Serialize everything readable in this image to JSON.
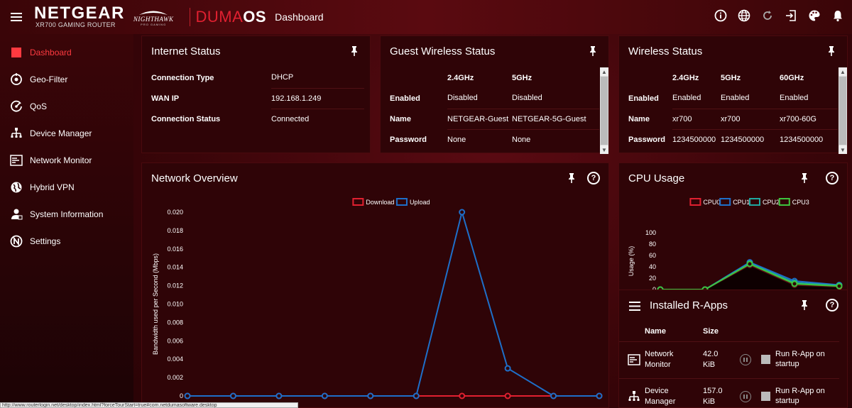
{
  "header": {
    "brand": "NETGEAR",
    "model": "XR700 GAMING ROUTER",
    "nighthawk": "NIGHTHAWK",
    "nighthawk_sub": "PRO GAMING",
    "duma": "DUMA",
    "duma_os": "OS",
    "page_title": "Dashboard",
    "icons": [
      "info-icon",
      "globe-icon",
      "refresh-icon",
      "logout-icon",
      "palette-icon",
      "bell-icon"
    ]
  },
  "sidebar": {
    "items": [
      {
        "label": "Dashboard",
        "icon": "dashboard-icon",
        "active": true
      },
      {
        "label": "Geo-Filter",
        "icon": "geo-filter-icon"
      },
      {
        "label": "QoS",
        "icon": "qos-icon"
      },
      {
        "label": "Device Manager",
        "icon": "device-manager-icon"
      },
      {
        "label": "Network Monitor",
        "icon": "network-monitor-icon"
      },
      {
        "label": "Hybrid VPN",
        "icon": "hybrid-vpn-icon"
      },
      {
        "label": "System Information",
        "icon": "system-info-icon"
      },
      {
        "label": "Settings",
        "icon": "settings-icon"
      }
    ]
  },
  "internet_status": {
    "title": "Internet Status",
    "rows": [
      {
        "key": "Connection Type",
        "value": "DHCP"
      },
      {
        "key": "WAN IP",
        "value": "192.168.1.249"
      },
      {
        "key": "Connection Status",
        "value": "Connected"
      }
    ]
  },
  "guest_wireless": {
    "title": "Guest Wireless Status",
    "headers": [
      "",
      "2.4GHz",
      "5GHz"
    ],
    "rows": [
      {
        "key": "Enabled",
        "v1": "Disabled",
        "v2": "Disabled"
      },
      {
        "key": "Name",
        "v1": "NETGEAR-Guest",
        "v2": "NETGEAR-5G-Guest"
      },
      {
        "key": "Password",
        "v1": "None",
        "v2": "None"
      }
    ]
  },
  "wireless": {
    "title": "Wireless Status",
    "headers": [
      "",
      "2.4GHz",
      "5GHz",
      "60GHz"
    ],
    "rows": [
      {
        "key": "Enabled",
        "v1": "Enabled",
        "v2": "Enabled",
        "v3": "Enabled"
      },
      {
        "key": "Name",
        "v1": "xr700",
        "v2": "xr700",
        "v3": "xr700-60G"
      },
      {
        "key": "Password",
        "v1": "1234500000",
        "v2": "1234500000",
        "v3": "1234500000"
      }
    ]
  },
  "network_overview": {
    "title": "Network Overview",
    "help": "?"
  },
  "cpu_usage": {
    "title": "CPU Usage",
    "help": "?"
  },
  "installed_rapps": {
    "title": "Installed R-Apps",
    "help": "?",
    "headers": {
      "name": "Name",
      "size": "Size"
    },
    "apps": [
      {
        "name": "Network Monitor",
        "size": "42.0 KiB",
        "startup": "Run R-App on startup",
        "icon": "network-monitor-icon"
      },
      {
        "name": "Device Manager",
        "size": "157.0 KiB",
        "startup": "Run R-App on startup",
        "icon": "device-manager-icon"
      }
    ]
  },
  "status_url": "http://www.routerlogin.net/desktop/index.html?forceTourStart=true#com.netdumasoftware.desktop",
  "colors": {
    "download": "#e02030",
    "upload": "#1e6fc9",
    "cpu0": "#e02030",
    "cpu1": "#1e6fc9",
    "cpu2": "#1fa8a0",
    "cpu3": "#3ec43e",
    "accent": "#ff3a40"
  },
  "chart_data": [
    {
      "type": "line",
      "title": "",
      "ylabel": "Bandwidth used per Second (Mbps)",
      "xlabel": "",
      "ylim": [
        0,
        0.02
      ],
      "yticks": [
        "0",
        "0.002",
        "0.004",
        "0.006",
        "0.008",
        "0.010",
        "0.012",
        "0.014",
        "0.016",
        "0.018",
        "0.020"
      ],
      "x": [
        0,
        1,
        2,
        3,
        4,
        5,
        6,
        7,
        8,
        9
      ],
      "series": [
        {
          "name": "Download",
          "values": [
            0,
            0,
            0,
            0,
            0,
            0,
            0,
            0,
            0,
            0
          ]
        },
        {
          "name": "Upload",
          "values": [
            0,
            0,
            0,
            0,
            0,
            0,
            0.02,
            0.003,
            0,
            0
          ]
        }
      ],
      "legend": "top-center"
    },
    {
      "type": "line",
      "title": "",
      "ylabel": "Usage (%)",
      "ylim": [
        0,
        100
      ],
      "yticks": [
        "0",
        "20",
        "40",
        "60",
        "80",
        "100"
      ],
      "x": [
        0,
        1,
        2,
        3,
        4
      ],
      "series": [
        {
          "name": "CPU0",
          "values": [
            0,
            0,
            43,
            8,
            5
          ]
        },
        {
          "name": "CPU1",
          "values": [
            0,
            0,
            48,
            15,
            8
          ]
        },
        {
          "name": "CPU2",
          "values": [
            0,
            0,
            46,
            12,
            7
          ]
        },
        {
          "name": "CPU3",
          "values": [
            0,
            0,
            45,
            10,
            6
          ]
        }
      ],
      "legend": "top-center"
    }
  ]
}
